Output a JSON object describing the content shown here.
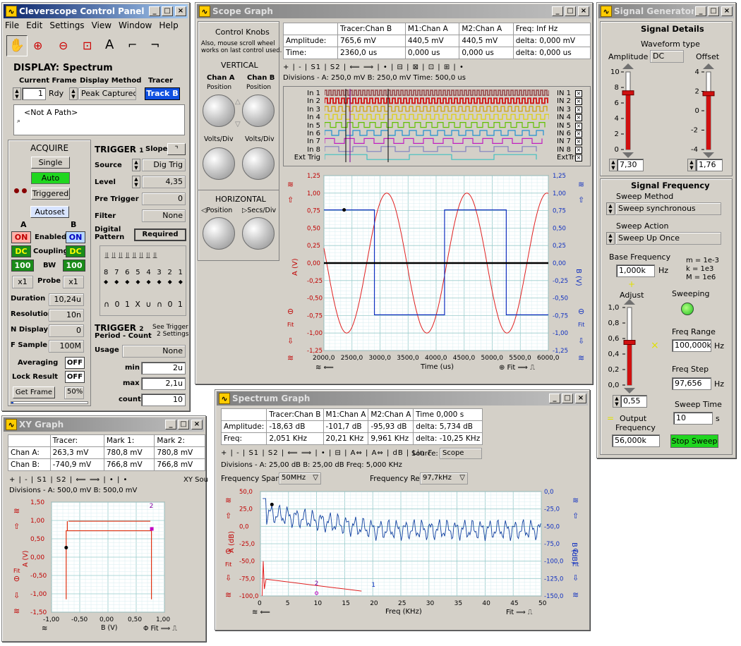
{
  "control_panel": {
    "title": "Cleverscope Control Panel",
    "menu": [
      "File",
      "Edit",
      "Settings",
      "View",
      "Window",
      "Help"
    ],
    "display_label": "DISPLAY:",
    "display_value": "Spectrum",
    "current_frame_label": "Current Frame",
    "current_frame_value": "1",
    "rdy": "Rdy",
    "display_method_label": "Display Method",
    "display_method_value": "Peak Captured",
    "tracer_label": "Tracer",
    "tracer_value": "Track B",
    "path_value": "<Not A Path>",
    "acquire_label": "ACQUIRE",
    "single": "Single",
    "auto": "Auto",
    "triggered": "Triggered",
    "autoset": "Autoset",
    "col_a": "A",
    "col_b": "B",
    "on": "ON",
    "enabled": "Enabled",
    "dc": "DC",
    "coupling": "Coupling",
    "bw_val": "100",
    "bw": "BW",
    "probe_val": "x1",
    "probe": "Probe",
    "duration_label": "Duration",
    "duration_value": "10,24u",
    "resolution_label": "Resolution",
    "resolution_value": "10n",
    "ndisplay_label": "N Display",
    "ndisplay_value": "0",
    "fsample_label": "F Sample",
    "fsample_value": "100M",
    "averaging_label": "Averaging",
    "averaging_value": "OFF",
    "lock_label": "Lock Result",
    "lock_value": "OFF",
    "get_frame": "Get Frame",
    "percent": "50%",
    "trigger1_label": "TRIGGER",
    "trigger1_num": "1",
    "slope_label": "Slope",
    "source_label": "Source",
    "source_value": "Dig Trig",
    "level_label": "Level",
    "level_value": "4,35",
    "pretrigger_label": "Pre Trigger",
    "pretrigger_value": "0",
    "filter_label": "Filter",
    "filter_value": "None",
    "digital_pattern_label": "Digital Pattern",
    "digital_pattern_value": "Required",
    "bits": [
      "8",
      "7",
      "6",
      "5",
      "4",
      "3",
      "2",
      "1"
    ],
    "pattern": [
      "∩",
      "0",
      "1",
      "X",
      "∪",
      "∩",
      "0",
      "1"
    ],
    "trigger2_label": "TRIGGER",
    "trigger2_num": "2",
    "period_count": "Period - Count",
    "see_trigger": "See Trigger",
    "two_settings": "2 Settings",
    "usage_label": "Usage",
    "usage_value": "None",
    "min_label": "min",
    "min_value": "2u",
    "max_label": "max",
    "max_value": "2,1u",
    "count_label": "count",
    "count_value": "10"
  },
  "scope": {
    "title": "Scope Graph",
    "knobs_title": "Control Knobs",
    "knobs_hint1": "Also, mouse scroll wheel",
    "knobs_hint2": "works on last control used.",
    "vertical": "VERTICAL",
    "chan_a": "Chan A",
    "chan_b": "Chan B",
    "position": "Position",
    "volts_div": "Volts/Div",
    "horizontal": "HORIZONTAL",
    "secs_div": "Secs/Div",
    "table": {
      "headers": [
        "",
        "Tracer:Chan B",
        "M1:Chan A",
        "M2:Chan A",
        "Freq:  Inf Hz"
      ],
      "rows": [
        [
          "Amplitude:",
          "765,6 mV",
          "440,5 mV",
          "440,5 mV",
          "delta:  0,000 mV"
        ],
        [
          "Time:",
          "2360,0 us",
          "0,000 us",
          "0,000 us",
          "delta:  0,000 us"
        ]
      ]
    },
    "divisions": "Divisions -  A: 250,0 mV   B: 250,0 mV   Time: 500,0 us",
    "digital_left": [
      "In 1",
      "In 2",
      "In 3",
      "In 4",
      "In 5",
      "In 6",
      "In 7",
      "In 8",
      "Ext Trig"
    ],
    "digital_right": [
      "IN 1",
      "IN 2",
      "IN 3",
      "IN 4",
      "IN 5",
      "IN 6",
      "IN 7",
      "IN 8",
      "ExtTri"
    ],
    "xlabel": "Time (us)",
    "ylabel_left": "A (V)",
    "ylabel_right": "B (V)",
    "fit": "Fit"
  },
  "signal_gen": {
    "title": "Signal Generator C...",
    "details": "Signal  Details",
    "waveform_label": "Waveform type",
    "amplitude_label": "Amplitude",
    "waveform_value": "DC",
    "offset_label": "Offset",
    "amp_ticks": [
      "10",
      "8",
      "6",
      "4",
      "2",
      "0"
    ],
    "off_ticks": [
      "4",
      "2",
      "0",
      "-2",
      "-4"
    ],
    "amp_value": "7,30",
    "off_value": "1,76",
    "amp_level": 7.3,
    "off_level": 1.76,
    "freq_title": "Signal Frequency",
    "sweep_method_label": "Sweep Method",
    "sweep_method_value": "Sweep synchronous",
    "sweep_action_label": "Sweep Action",
    "sweep_action_value": "Sweep Up Once",
    "base_freq_label": "Base Frequency",
    "base_freq_value": "1,000k",
    "hz": "Hz",
    "m_note": "m = 1e-3",
    "k_note": "k = 1e3",
    "M_note": "M = 1e6",
    "adjust_label": "Adjust",
    "sweeping_label": "Sweeping",
    "adj_ticks": [
      "1,0",
      "0,8",
      "0,6",
      "0,4",
      "0,2",
      "0,0"
    ],
    "adj_value": "0,55",
    "adj_level": 0.55,
    "freq_range_label": "Freq Range",
    "freq_range_value": "100,000k",
    "freq_step_label": "Freq Step",
    "freq_step_value": "97,656",
    "sweep_time_label": "Sweep Time",
    "sweep_time_value": "10",
    "s": "s",
    "output_label": "Output",
    "frequency_label": "Frequency",
    "output_value": "56,000k",
    "stop_sweep": "Stop Sweep"
  },
  "xy": {
    "title": "XY Graph",
    "table": {
      "headers": [
        "",
        "Tracer:",
        "Mark 1:",
        "Mark 2:"
      ],
      "rows": [
        [
          "Chan A:",
          "263,3 mV",
          "780,8 mV",
          "780,8 mV"
        ],
        [
          "Chan B:",
          "-740,9 mV",
          "766,8 mV",
          "766,8 mV"
        ]
      ]
    },
    "xy_sou": "XY Sou",
    "divisions": "Divisions -  A: 500,0 mV   B: 500,0 mV",
    "xlabel": "B (V)",
    "ylabel": "A (V)",
    "fit": "Fit"
  },
  "spectrum": {
    "title": "Spectrum Graph",
    "table": {
      "headers": [
        "",
        "Tracer:Chan B",
        "M1:Chan A",
        "M2:Chan A",
        "Time  0,000 s"
      ],
      "rows": [
        [
          "Amplitude:",
          "-18,63 dB",
          "-101,7 dB",
          "-95,93 dB",
          "delta:  5,734 dB"
        ],
        [
          "Freq:",
          "2,051 KHz",
          "20,21 KHz",
          "9,961 KHz",
          "delta:  -10,25 KHz"
        ]
      ]
    },
    "source_label": "Source:",
    "source_value": "Scope",
    "divisions": "Divisions -  A: 25,00 dB   B: 25,00 dB   Freq: 5,000 KHz",
    "span_label": "Frequency Span",
    "span_value": "50MHz",
    "res_label": "Frequency Res",
    "res_value": "97,7kHz",
    "xlabel": "Freq (KHz)",
    "ylabel_left": "A (dB)",
    "ylabel_right": "B (dB)",
    "fit": "Fit"
  },
  "chart_data": [
    {
      "type": "line",
      "x_range": [
        2000,
        6000
      ],
      "xlabel": "Time (us)",
      "ylabel": "A (V)",
      "ylabel_right": "B (V)",
      "ylim": [
        -1.25,
        1.25
      ],
      "x_ticks": [
        "2000,0",
        "2500,0",
        "3000,0",
        "3500,0",
        "4000,0",
        "4500,0",
        "5000,0",
        "5500,0",
        "6000,0"
      ],
      "y_ticks_left": [
        "1,25",
        "1,00",
        "0,75",
        "0,50",
        "0,25",
        "0,00",
        "-0,25",
        "-0,50",
        "-0,75",
        "-1,00",
        "-1,25"
      ],
      "y_ticks_right": [
        "1,25",
        "1,00",
        "0,75",
        "0,50",
        "0,25",
        "0,00",
        "-0,25",
        "-0,50",
        "-0,75",
        "-1,00",
        "-1,25"
      ],
      "series": [
        {
          "name": "Chan A",
          "color": "#e02020",
          "shape": "sine",
          "amplitude": 1.0,
          "period_us": 1428,
          "peak_at_us": 3120
        },
        {
          "name": "Chan B",
          "color": "#1030c0",
          "shape": "square",
          "high": 0.76,
          "low": -0.74,
          "transitions_us": [
            2900,
            4150,
            5250
          ]
        }
      ]
    },
    {
      "type": "line",
      "x_range": [
        0,
        50
      ],
      "xlabel": "Freq (KHz)",
      "ylabel": "A (dB)",
      "ylabel_right": "B (dB)",
      "x_ticks": [
        "0",
        "5",
        "10",
        "15",
        "20",
        "25",
        "30",
        "35",
        "40",
        "45",
        "50"
      ],
      "y_ticks_left": [
        "50,0",
        "25,0",
        "0,0",
        "-25,0",
        "-50,0",
        "-75,0",
        "-100,0"
      ],
      "y_ticks_right": [
        "0,0",
        "-25,0",
        "-50,0",
        "-75,0",
        "-100,0",
        "-125,0",
        "-150,0"
      ],
      "series": [
        {
          "name": "Chan A",
          "color": "#e02020"
        },
        {
          "name": "Chan B",
          "color": "#1030c0"
        }
      ]
    },
    {
      "type": "scatter",
      "xlabel": "B (V)",
      "ylabel": "A (V)",
      "x_ticks": [
        "-1,00",
        "-0,50",
        "0,00",
        "0,50",
        "1,00"
      ],
      "y_ticks": [
        "1,50",
        "1,00",
        "0,50",
        "0,00",
        "-0,50",
        "-1,00",
        "-1,50"
      ]
    }
  ]
}
